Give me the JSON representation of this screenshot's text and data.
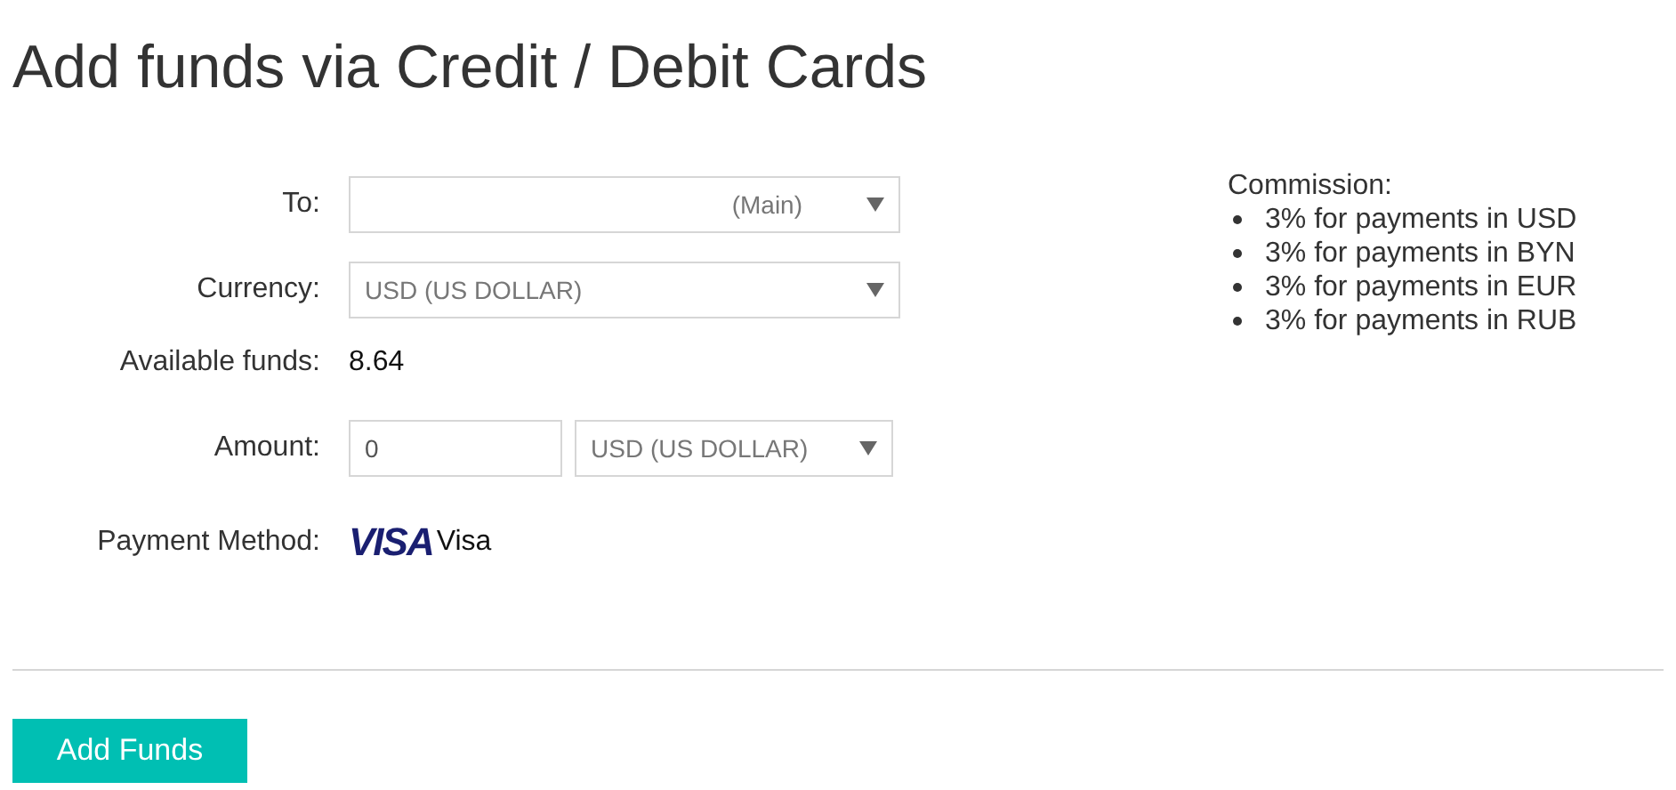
{
  "title": "Add funds via Credit / Debit Cards",
  "form": [
    {
      "label": "To:",
      "kind": "account",
      "value": "(Main)"
    },
    {
      "label": "Currency:",
      "kind": "select",
      "value": "USD (US DOLLAR)"
    },
    {
      "label": "Available funds:",
      "kind": "text",
      "value": "8.64"
    },
    {
      "label": "Amount:",
      "kind": "amount",
      "value": "0",
      "currency": "USD (US DOLLAR)"
    },
    {
      "label": "Payment Method:",
      "kind": "payment",
      "logo": "VISA",
      "value": "Visa"
    }
  ],
  "commission": {
    "heading": "Commission:",
    "items": [
      "3% for payments in USD",
      "3% for payments in BYN",
      "3% for payments in EUR",
      "3% for payments in RUB"
    ]
  },
  "submit": "Add Funds"
}
